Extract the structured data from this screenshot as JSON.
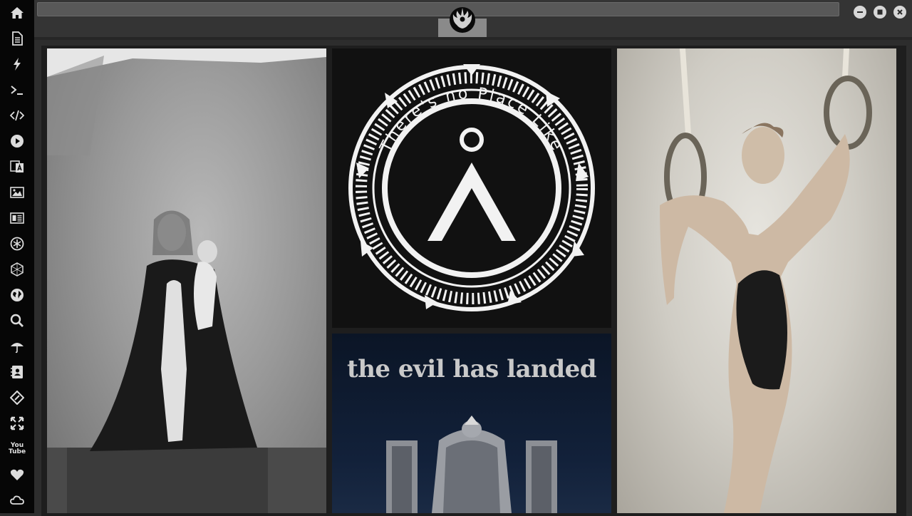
{
  "sidebar": {
    "items": [
      {
        "name": "home-icon"
      },
      {
        "name": "document-icon"
      },
      {
        "name": "lightning-icon"
      },
      {
        "name": "terminal-icon"
      },
      {
        "name": "code-icon"
      },
      {
        "name": "play-icon"
      },
      {
        "name": "translate-icon"
      },
      {
        "name": "image-icon"
      },
      {
        "name": "news-icon"
      },
      {
        "name": "rebel-alliance-icon"
      },
      {
        "name": "hexagon-icon"
      },
      {
        "name": "globe-icon"
      },
      {
        "name": "search-icon"
      },
      {
        "name": "umbrella-icon"
      },
      {
        "name": "contact-card-icon"
      },
      {
        "name": "git-diamond-icon"
      },
      {
        "name": "fullscreen-icon"
      },
      {
        "name": "youtube-icon",
        "label": "You\nTube"
      },
      {
        "name": "heart-icon"
      },
      {
        "name": "cloud-icon"
      }
    ]
  },
  "topbar": {
    "address_value": "",
    "logo_icon": "rebel-alliance-logo"
  },
  "window_controls": [
    "minimize",
    "maximize",
    "close"
  ],
  "tiles": {
    "poster_title": "the evil has landed",
    "stargate_text": "There's no Place Like"
  },
  "colors": {
    "sidebar_bg": "#060606",
    "topbar_bg": "#343434",
    "icon_color": "#dcdcdc"
  }
}
